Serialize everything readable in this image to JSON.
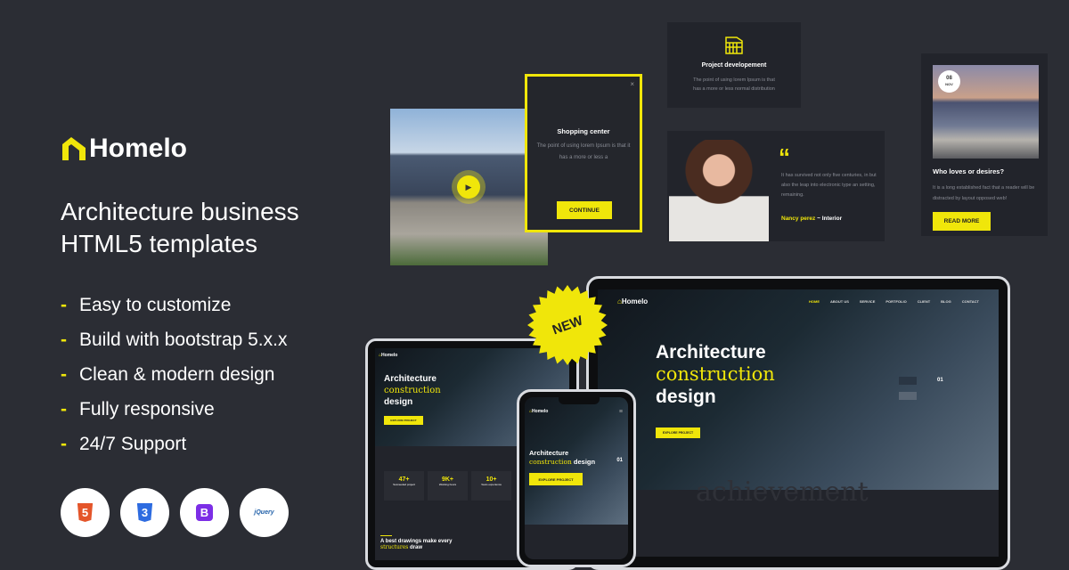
{
  "brand": {
    "name": "Homelo",
    "accent": "#f0e60a",
    "background": "#2b2d34"
  },
  "headline": [
    "Architecture business",
    "HTML5 templates"
  ],
  "features": [
    "Easy to customize",
    "Build with bootstrap 5.x.x",
    "Clean & modern design",
    "Fully responsive",
    "24/7 Support"
  ],
  "tech": [
    {
      "icon": "html5-icon",
      "label": "5"
    },
    {
      "icon": "css3-icon",
      "label": "3"
    },
    {
      "icon": "bootstrap-icon",
      "label": "B"
    },
    {
      "icon": "jquery-icon",
      "label": "jQuery"
    }
  ],
  "badge": "NEW",
  "popup": {
    "title": "Shopping center",
    "text": "The point of using lorem Ipsum is that it has a more or less a",
    "close": "×",
    "button": "CONTINUE"
  },
  "service": {
    "title": "Project developement",
    "text": "The point of using lorem Ipsum is that has a more or less normal distribution"
  },
  "testimonial": {
    "quote": "“",
    "text": "It has survived not only five centuries, in but also the leap into electronic type an setting, remaining.",
    "name": "Nancy perez",
    "role": "~ Interior"
  },
  "blog": {
    "day": "08",
    "month": "NOV",
    "title": "Who loves or desires?",
    "text": "It is a long established fact that a reader will be distracted by layout opposed web!",
    "button": "READ MORE"
  },
  "laptop": {
    "nav": [
      "HOME",
      "ABOUT US",
      "SERVICE",
      "PORTFOLIO",
      "CLIENT",
      "BLOG",
      "CONTACT"
    ],
    "hero": [
      "Architecture",
      "construction",
      "design"
    ],
    "button": "EXPLORE PROJECT",
    "slide": "01",
    "watermark": "achievement"
  },
  "tablet": {
    "hero": [
      "Architecture",
      "construction",
      "design"
    ],
    "button": "EXPLORE PROJECT",
    "stats": [
      {
        "value": "47+",
        "label": "Succeeded project"
      },
      {
        "value": "9K+",
        "label": "Working hours"
      },
      {
        "value": "10+",
        "label": "Years experience"
      }
    ],
    "about_title": [
      "A best drawings make every",
      "structures",
      "draw"
    ]
  },
  "phone": {
    "hero_line1": "Architecture",
    "hero_y": "construction",
    "hero_w": "design",
    "button": "EXPLORE PROJECT",
    "slide": "01"
  }
}
